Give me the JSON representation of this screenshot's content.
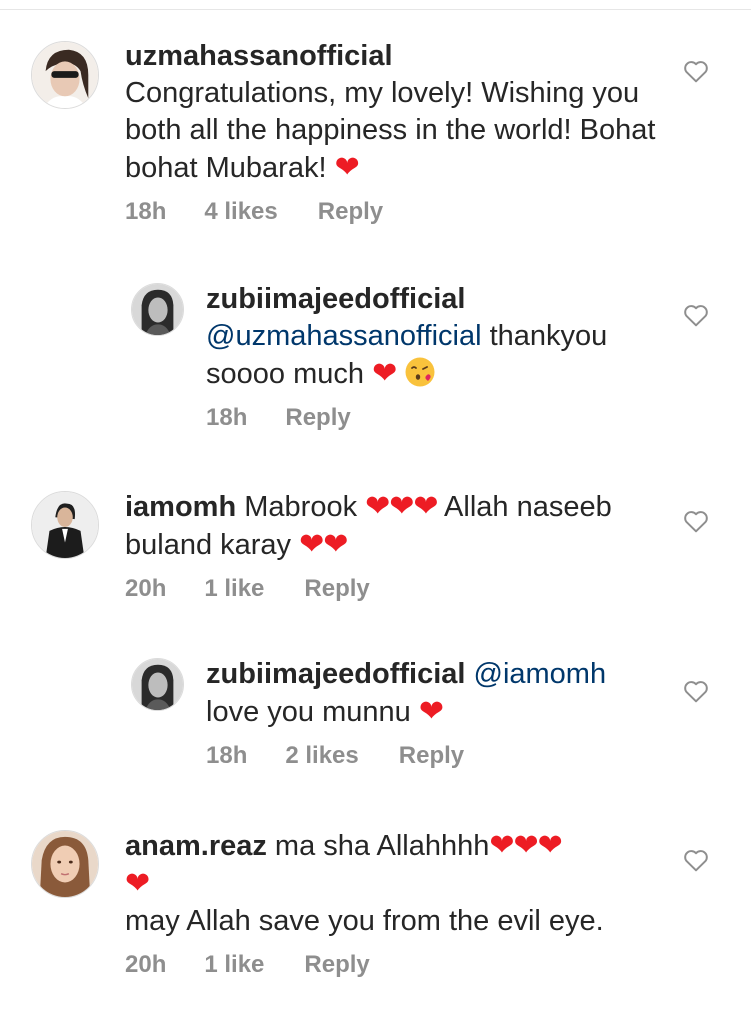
{
  "comments": [
    {
      "username": "uzmahassanofficial",
      "mention": "",
      "text": "Congratulations, my lovely! Wishing you both all the happiness in the world! Bohat bohat Mubarak!",
      "emoji": "❤",
      "time": "18h",
      "likes": "4 likes",
      "reply_label": "Reply"
    },
    {
      "username": "zubiimajeedofficial",
      "mention": "@uzmahassanofficial",
      "text": "thankyou soooo much",
      "emoji": "❤",
      "time": "18h",
      "likes": "",
      "reply_label": "Reply"
    },
    {
      "username": "iamomh",
      "mention": "",
      "text_part1": "Mabrook",
      "emoji1": "❤❤❤",
      "text_part2": "Allah naseeb buland karay",
      "emoji2": "❤❤",
      "time": "20h",
      "likes": "1 like",
      "reply_label": "Reply"
    },
    {
      "username": "zubiimajeedofficial",
      "mention": "@iamomh",
      "text": "love you munnu",
      "emoji": "❤",
      "time": "18h",
      "likes": "2 likes",
      "reply_label": "Reply"
    },
    {
      "username": "anam.reaz",
      "mention": "",
      "text_part1": "ma sha Allahhhh",
      "emoji1": "❤❤❤",
      "emoji2": "❤",
      "text_part2": "may Allah save you from the evil eye.",
      "time": "20h",
      "likes": "1 like",
      "reply_label": "Reply"
    }
  ],
  "icons": {
    "like": "heart-outline-icon",
    "kiss": "face-blowing-kiss-icon"
  },
  "colors": {
    "text": "#262626",
    "meta": "#8e8e8e",
    "mention": "#00376b",
    "heart": "#ed1c24"
  }
}
